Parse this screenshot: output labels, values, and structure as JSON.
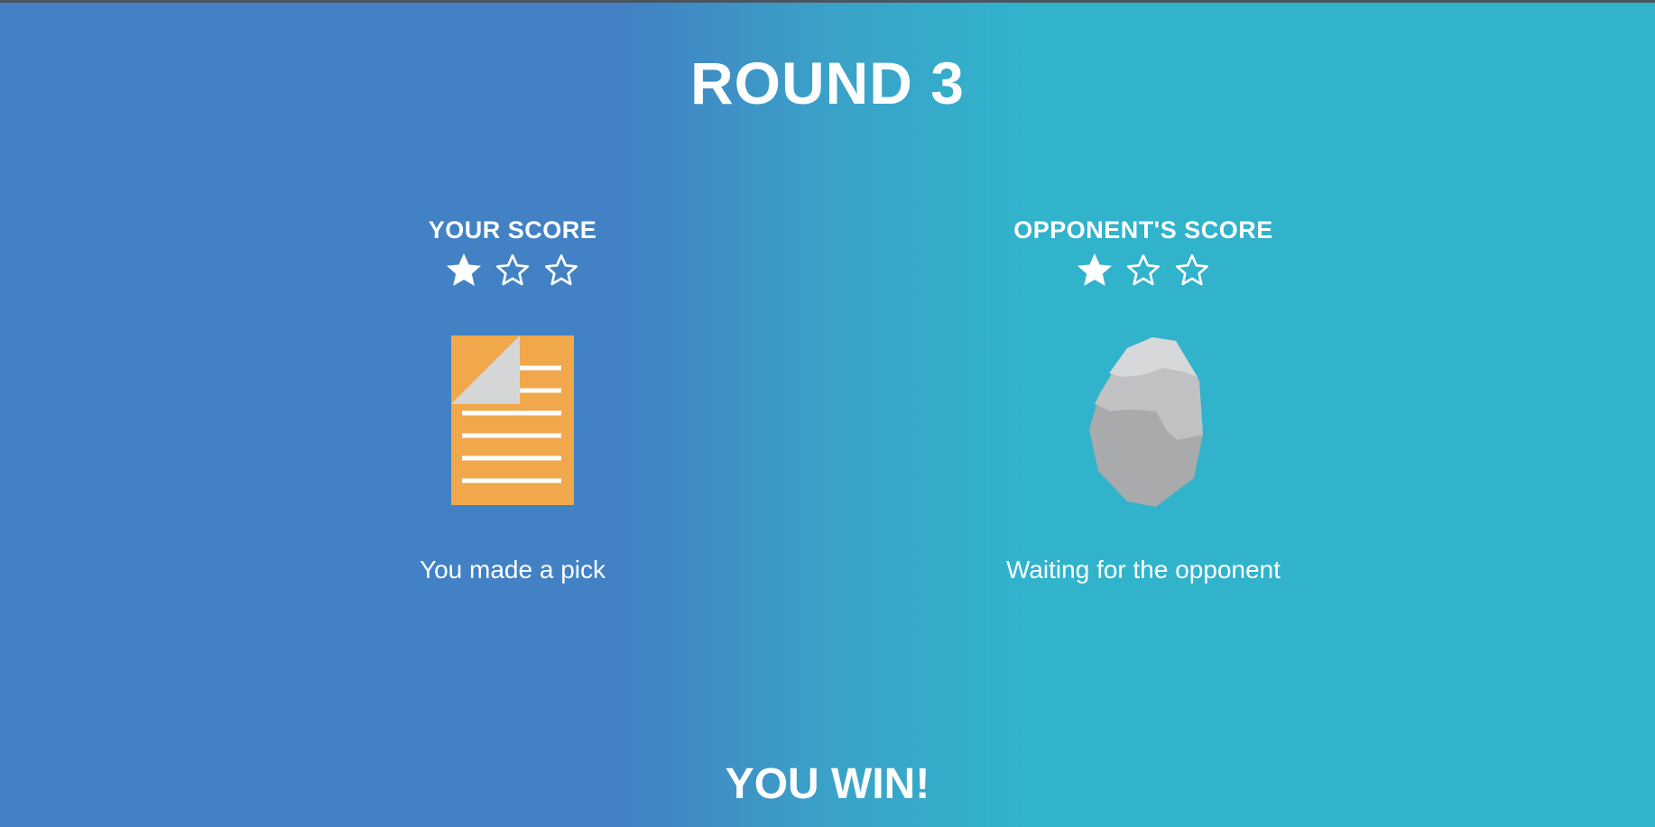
{
  "game": {
    "round_title": "ROUND 3",
    "result_text": "YOU WIN!"
  },
  "players": {
    "you": {
      "score_label": "YOUR SCORE",
      "stars_total": 3,
      "stars_filled": 1,
      "pick": "paper",
      "pick_icon": "paper-document-icon",
      "status": "You made a pick"
    },
    "opponent": {
      "score_label": "OPPONENT'S SCORE",
      "stars_total": 3,
      "stars_filled": 1,
      "pick": "rock",
      "pick_icon": "rock-icon",
      "status": "Waiting for the opponent"
    }
  },
  "colors": {
    "background_left": "#4282c4",
    "background_right": "#31b3cc",
    "paper": "#f0a84b",
    "paper_fold": "#d4d6d8",
    "rock_light": "#d7d8d9",
    "rock_mid": "#c0c1c3",
    "rock_dark": "#a9aaac"
  }
}
